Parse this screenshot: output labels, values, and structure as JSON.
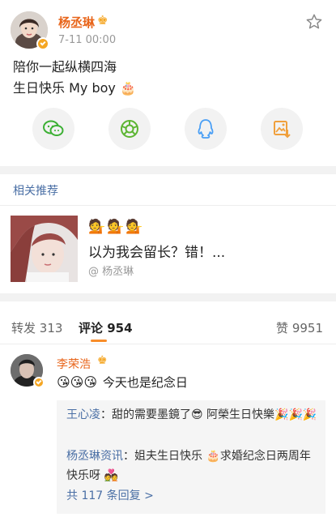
{
  "post": {
    "author": "杨丞琳",
    "crown_icon": "crown-icon",
    "time": "7-11 00:00",
    "line1": "陪你一起纵横四海",
    "line2": "生日快乐 My boy 🎂"
  },
  "share": {
    "items": [
      "wechat-icon",
      "moments-icon",
      "qq-icon",
      "save-image-icon"
    ],
    "accent_colors": [
      "#3cb034",
      "#5cb532",
      "#4a9ff5",
      "#f0a03c"
    ]
  },
  "related": {
    "title": "相关推荐",
    "emoji": "💁💁💁",
    "headline": "以为我会留长？错！...",
    "author": "@ 杨丞琳"
  },
  "tabs": {
    "repost": "转发",
    "repost_count": "313",
    "comment": "评论",
    "comment_count": "954",
    "like": "赞",
    "like_count": "9951"
  },
  "comment": {
    "author": "李荣浩",
    "emoji": "😘😘😘",
    "text": "今天也是纪念日",
    "replies": [
      {
        "name": "王心凌",
        "sep": "：",
        "text": "甜的需要墨鏡了😎 阿榮生日快樂🎉🎉🎉"
      },
      {
        "name": "杨丞琳资讯",
        "sep": "：",
        "text": "姐夫生日快乐 🎂求婚纪念日两周年快乐呀 💑"
      }
    ],
    "more": "共 117 条回复 >"
  },
  "colors": {
    "name_orange": "#e8661c",
    "link_blue": "#4a6fa5",
    "tab_underline": "#f88d2a",
    "vip_badge": "#f5a623"
  }
}
